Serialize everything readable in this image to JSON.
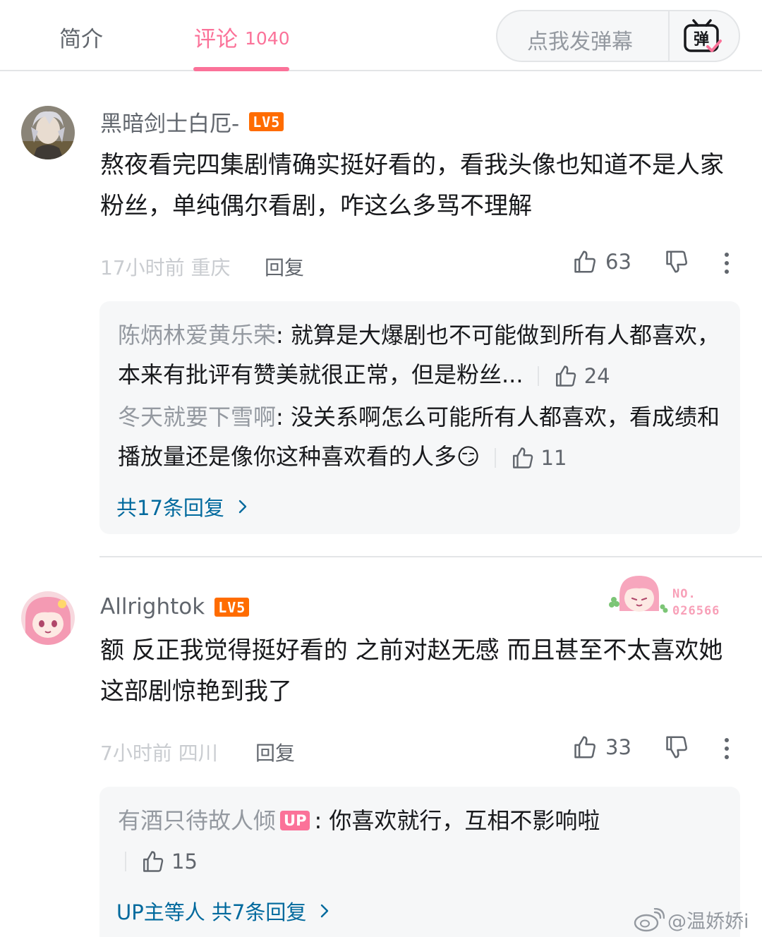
{
  "tabs": {
    "intro_label": "简介",
    "comments_label": "评论",
    "comments_count": "1040"
  },
  "danmaku": {
    "placeholder": "点我发弹幕",
    "icon_text": "弹"
  },
  "comments": [
    {
      "username": "黑暗剑士白厄-",
      "level": "LV5",
      "text": "熬夜看完四集剧情确实挺好看的，看我头像也知道不是人家粉丝，单纯偶尔看剧，咋这么多骂不理解",
      "time_location": "17小时前 重庆",
      "reply_label": "回复",
      "likes": "63",
      "replies": [
        {
          "name": "陈炳林爱黄乐荣",
          "text": ": 就算是大爆剧也不可能做到所有人都喜欢，本来有批评有赞美就很正常，但是粉丝...",
          "likes": "24"
        },
        {
          "name": "冬天就要下雪啊",
          "text": ": 没关系啊怎么可能所有人都喜欢，看成绩和播放量还是像你这种喜欢看的人多",
          "emoji": "😏",
          "likes": "11"
        }
      ],
      "more_replies": "共17条回复"
    },
    {
      "username": "Allrightok",
      "level": "LV5",
      "fan_badge_no": "NO.",
      "fan_badge_num": "026566",
      "text": "额 反正我觉得挺好看的 之前对赵无感 而且甚至不太喜欢她 这部剧惊艳到我了",
      "time_location": "7小时前 四川",
      "reply_label": "回复",
      "likes": "33",
      "replies": [
        {
          "name": "有酒只待故人倾",
          "badge": "UP",
          "text": ": 你喜欢就行，互相不影响啦",
          "likes": "15"
        }
      ],
      "more_replies": "UP主等人 共7条回复"
    }
  ],
  "watermark": "@温娇娇i",
  "colors": {
    "accent_pink": "#fb7299",
    "level_orange": "#ff6c00",
    "link_blue": "#00699d",
    "reply_bg": "#f6f7f8"
  }
}
